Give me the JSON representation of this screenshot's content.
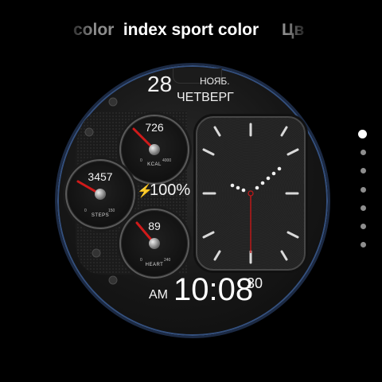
{
  "carousel": {
    "prev_label": "color",
    "current_label": "index sport color",
    "next_label": "Цв"
  },
  "watchface": {
    "date_day": "28",
    "date_month": "НОЯБ.",
    "weekday": "ЧЕТВЕРГ",
    "calories": {
      "value": "726",
      "label": "KCAL",
      "min": "0",
      "max": "4000"
    },
    "steps": {
      "value": "3457",
      "label": "STEPS",
      "min": "0",
      "max": "150"
    },
    "heart": {
      "value": "89",
      "label": "HEART",
      "min": "0",
      "max": "240"
    },
    "battery": "100%",
    "ampm": "AM",
    "time": "10:08",
    "seconds": "30"
  },
  "pager": {
    "count": 7,
    "active_index": 0
  },
  "colors": {
    "accent_red": "#d01a1a",
    "bezel_blue": "#34507e",
    "bolt_yellow": "#ffd21a"
  }
}
